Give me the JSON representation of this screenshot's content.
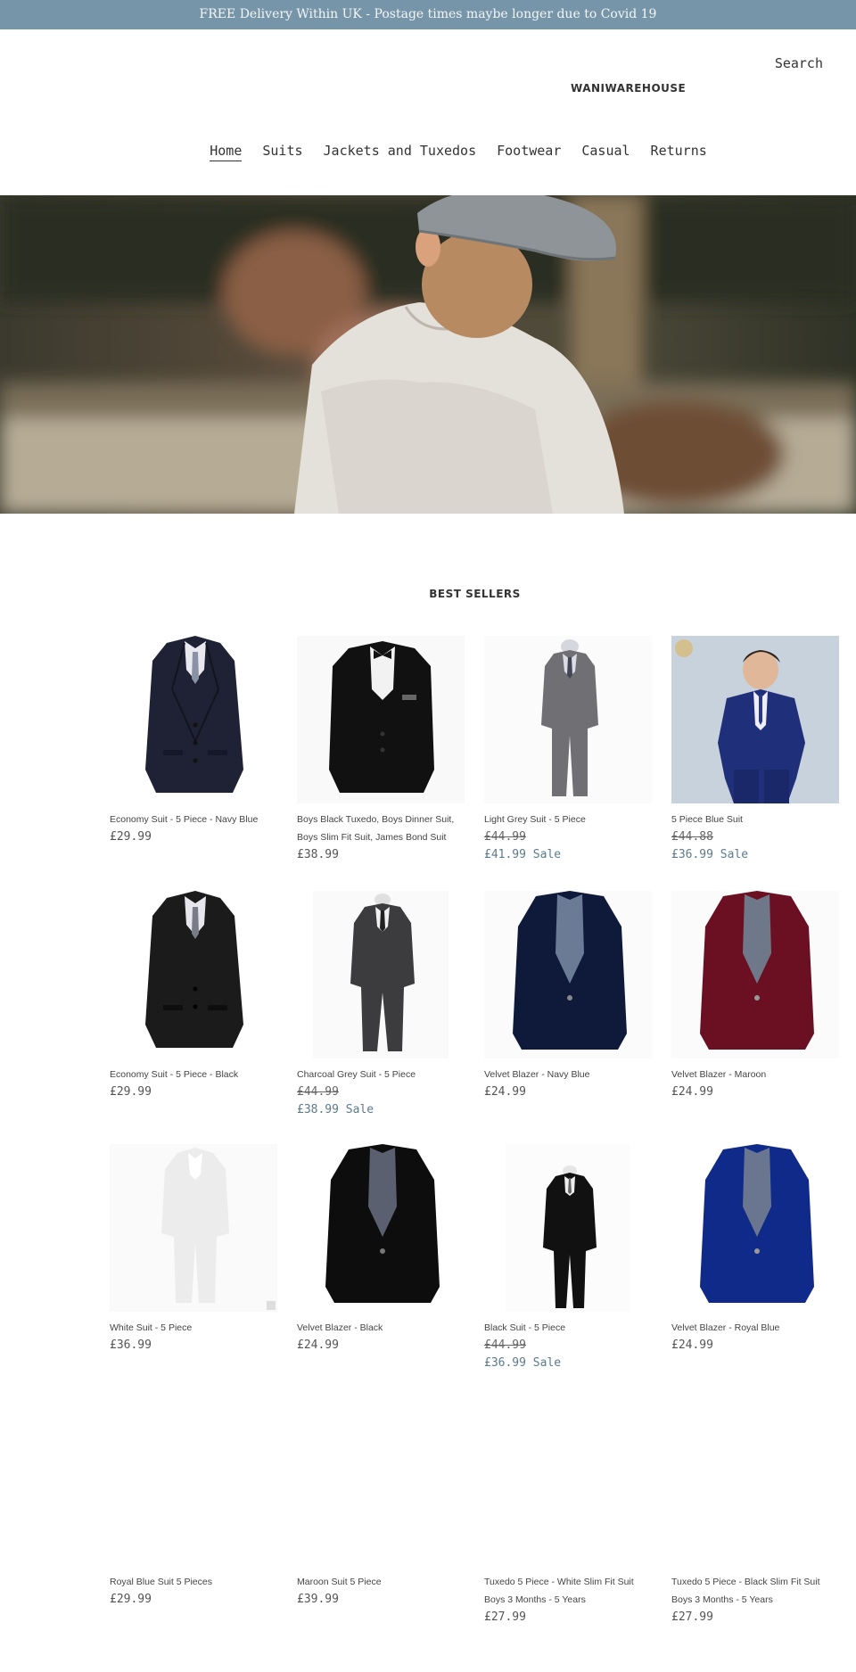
{
  "announcement": "FREE Delivery Within UK - Postage times maybe longer due to Covid 19",
  "header": {
    "search_label": "Search",
    "logo_text": "WANIWAREHOUSE"
  },
  "nav": [
    "Home",
    "Suits",
    "Jackets and Tuxedos",
    "Footwear",
    "Casual",
    "Returns"
  ],
  "section_title": "BEST SELLERS",
  "products": [
    {
      "title": "Economy Suit - 5 Piece - Navy Blue",
      "price": "£29.99"
    },
    {
      "title": "Boys Black Tuxedo, Boys Dinner Suit, Boys Slim Fit Suit, James Bond Suit",
      "price": "£38.99"
    },
    {
      "title": "Light Grey Suit - 5 Piece",
      "compare_price": "£44.99",
      "price": "£41.99 Sale"
    },
    {
      "title": "5 Piece Blue Suit",
      "compare_price": "£44.88",
      "price": "£36.99 Sale"
    },
    {
      "title": "Economy Suit - 5 Piece - Black",
      "price": "£29.99"
    },
    {
      "title": "Charcoal Grey Suit - 5 Piece",
      "compare_price": "£44.99",
      "price": "£38.99 Sale"
    },
    {
      "title": "Velvet Blazer - Navy Blue",
      "price": "£24.99"
    },
    {
      "title": "Velvet Blazer - Maroon",
      "price": "£24.99"
    },
    {
      "title": "White Suit - 5 Piece",
      "price": "£36.99"
    },
    {
      "title": "Velvet Blazer - Black",
      "price": "£24.99"
    },
    {
      "title": "Black Suit - 5 Piece",
      "compare_price": "£44.99",
      "price": "£36.99 Sale"
    },
    {
      "title": "Velvet Blazer - Royal Blue",
      "price": "£24.99"
    },
    {
      "title": "Royal Blue Suit 5 Pieces",
      "price": "£29.99"
    },
    {
      "title": "Maroon Suit 5 Piece",
      "price": "£39.99"
    },
    {
      "title": "Tuxedo 5 Piece - White Slim Fit Suit Boys 3 Months - 5 Years",
      "price": "£27.99"
    },
    {
      "title": "Tuxedo 5 Piece - Black Slim Fit Suit Boys 3 Months - 5 Years",
      "price": "£27.99"
    }
  ],
  "colors": {
    "announcement_bg": "#7795a8",
    "sale_text": "#5c7a8c",
    "text": "#333333"
  }
}
